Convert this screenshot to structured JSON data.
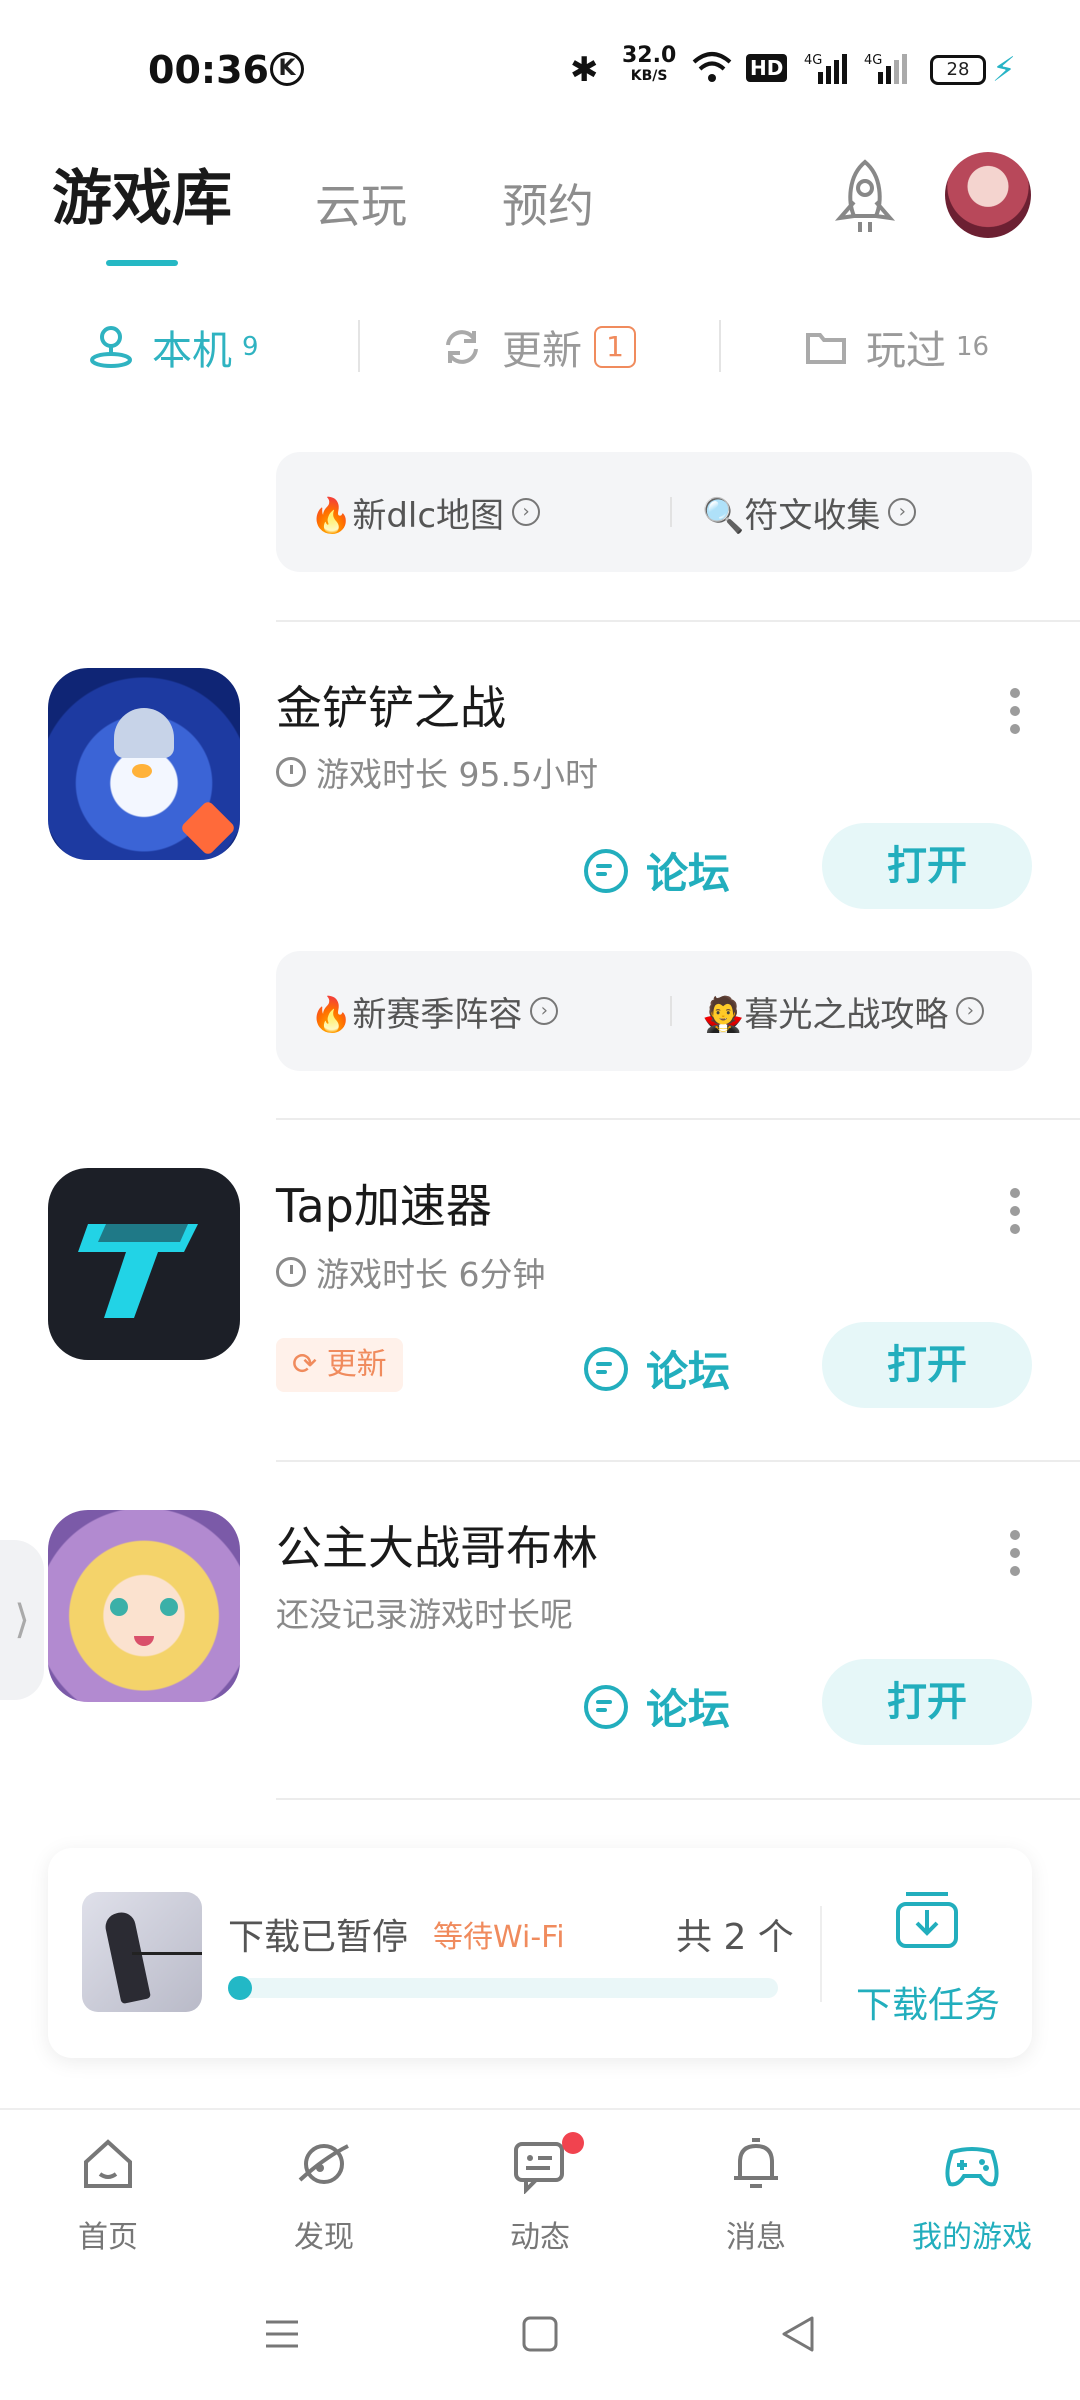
{
  "status_bar": {
    "time": "00:36",
    "k_icon": "K",
    "net_speed": "32.0",
    "net_unit": "KB/S",
    "hd": "HD",
    "sig1": "4G",
    "sig2": "4G",
    "battery": "28"
  },
  "header": {
    "tabs": [
      {
        "label": "游戏库"
      },
      {
        "label": "云玩"
      },
      {
        "label": "预约"
      }
    ]
  },
  "subtabs": [
    {
      "label": "本机",
      "count": "9"
    },
    {
      "label": "更新",
      "count": "1"
    },
    {
      "label": "玩过",
      "count": "16"
    }
  ],
  "chips_top": [
    {
      "label": "🔥新dlc地图"
    },
    {
      "label": "🔍符文收集"
    }
  ],
  "games": [
    {
      "name": "金铲铲之战",
      "playtime": "游戏时长 95.5小时",
      "forum": "论坛",
      "open": "打开"
    },
    {
      "name": "Tap加速器",
      "playtime": "游戏时长 6分钟",
      "update": "更新",
      "forum": "论坛",
      "open": "打开"
    },
    {
      "name": "公主大战哥布林",
      "playtime": "还没记录游戏时长呢",
      "forum": "论坛",
      "open": "打开"
    }
  ],
  "chips_game1": [
    {
      "label": "🔥新赛季阵容"
    },
    {
      "label": "🧛暮光之战攻略"
    }
  ],
  "download": {
    "status": "下载已暂停",
    "wait": "等待Wi-Fi",
    "count": "共 2 个",
    "progress": 0.02,
    "task_label": "下载任务"
  },
  "bottom_nav": [
    {
      "label": "首页",
      "icon": "home-icon"
    },
    {
      "label": "发现",
      "icon": "discover-icon"
    },
    {
      "label": "动态",
      "icon": "feed-icon"
    },
    {
      "label": "消息",
      "icon": "bell-icon"
    },
    {
      "label": "我的游戏",
      "icon": "gamepad-icon"
    }
  ],
  "colors": {
    "accent": "#22aebd",
    "orange": "#f08b5d",
    "red_dot": "#f1434f"
  }
}
